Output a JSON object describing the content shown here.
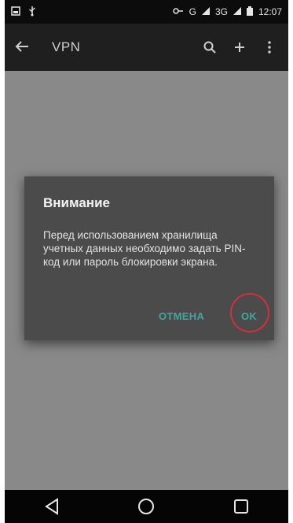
{
  "status_bar": {
    "network_label": "G",
    "data_label": "3G",
    "time": "12:07"
  },
  "toolbar": {
    "title": "VPN",
    "icons": [
      "back-arrow-icon",
      "search-icon",
      "add-icon",
      "more-vert-icon"
    ]
  },
  "dialog": {
    "title": "Внимание",
    "message": "Перед использованием хранилища учетных данных необходимо задать PIN-код или пароль блокировки экрана.",
    "cancel_label": "ОТМЕНА",
    "ok_label": "OK",
    "ok_highlight_color": "#d3303a"
  },
  "navigation": {
    "icons": [
      "back-triangle-icon",
      "home-circle-icon",
      "recents-square-icon"
    ]
  },
  "colors": {
    "accent": "#3fa7a0",
    "toolbar": "#1f1f1f",
    "scrim": "#898989",
    "dialog": "#4b4b4b"
  }
}
